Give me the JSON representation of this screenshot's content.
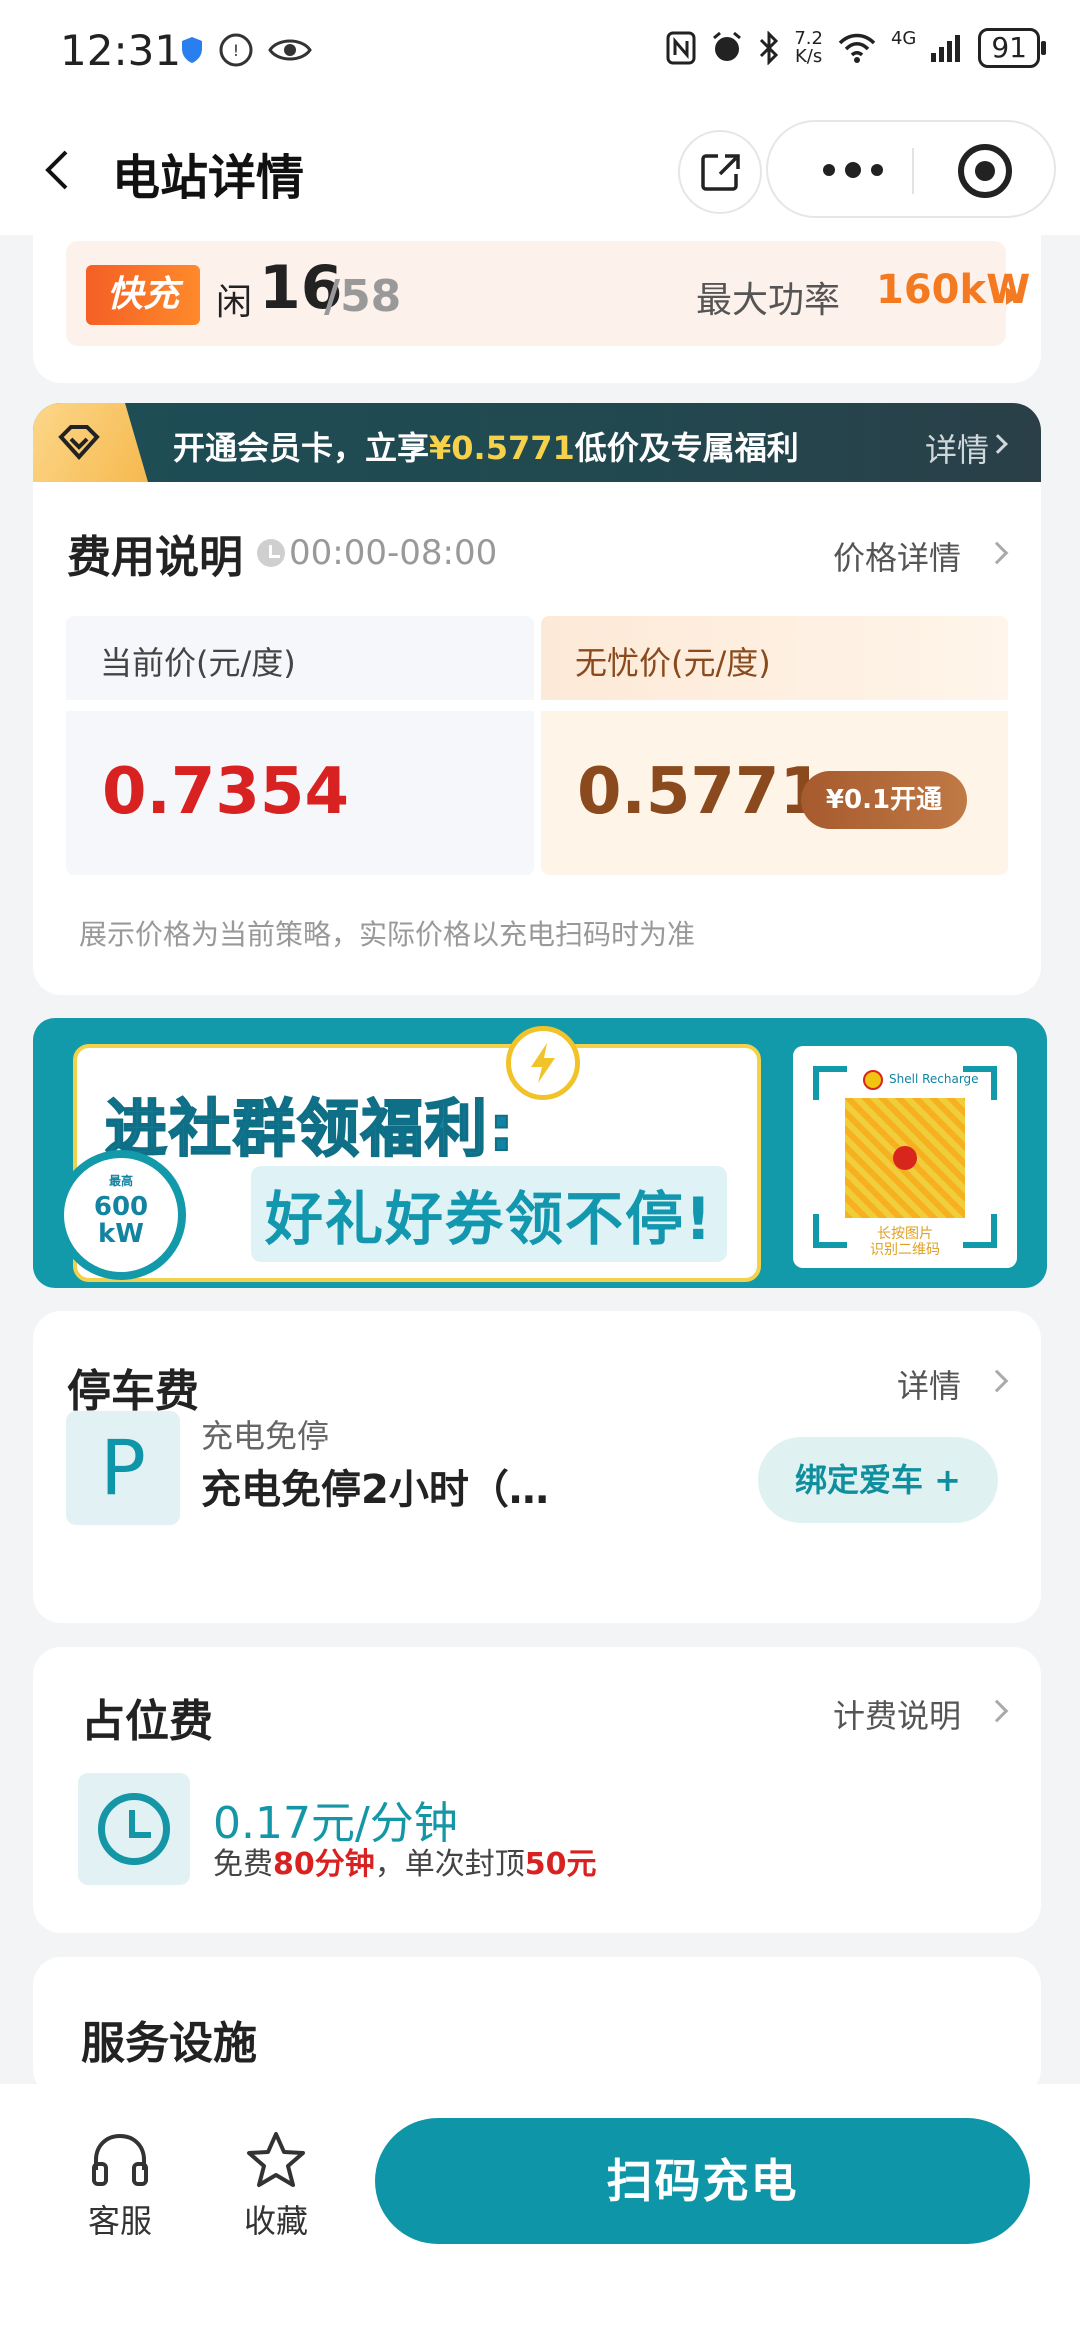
{
  "status_bar": {
    "time": "12:31",
    "net_speed_value": "7.2",
    "net_speed_unit": "K/s",
    "network_type": "4G",
    "battery": "91"
  },
  "nav": {
    "title": "电站详情"
  },
  "fast_charge": {
    "badge": "快充",
    "idle_label": "闲",
    "idle_count": "16",
    "total": "/58",
    "max_power_label": "最大功率",
    "max_power_value": "160kW"
  },
  "member_banner": {
    "text_prefix": "开通会员卡，立享",
    "highlight": "¥0.5771",
    "text_suffix": "低价及专属福利",
    "detail": "详情"
  },
  "fee": {
    "title": "费用说明",
    "time_range": "00:00-08:00",
    "price_detail_link": "价格详情",
    "current_label": "当前价(元/度)",
    "current_value": "0.7354",
    "vip_label": "无忧价(元/度)",
    "vip_value": "0.5771",
    "vip_button": "¥0.1开通",
    "note": "展示价格为当前策略，实际价格以充电扫码时为准"
  },
  "community_banner": {
    "title_line1": "进社群领福利:",
    "title_line2": "好礼好券领不停!",
    "badge_top": "最高",
    "badge_value": "600",
    "badge_unit": "kW",
    "qr_caption_line1": "长按图片",
    "qr_caption_line2": "识别二维码",
    "qr_brand": "Shell Recharge"
  },
  "parking": {
    "title": "停车费",
    "detail_link": "详情",
    "icon_letter": "P",
    "subtitle": "充电免停",
    "main_text": "充电免停2小时（…",
    "bind_button": "绑定爱车 +"
  },
  "occupancy": {
    "title": "占位费",
    "detail_link": "计费说明",
    "price": "0.17元/分钟",
    "note_prefix": "免费",
    "free_minutes": "80分钟",
    "note_mid": "，单次封顶",
    "cap": "50元"
  },
  "services": {
    "title": "服务设施"
  },
  "bottom_bar": {
    "service_label": "客服",
    "favorite_label": "收藏",
    "scan_button": "扫码充电"
  },
  "colors": {
    "brand_teal": "#0f95a8",
    "price_red": "#d82221",
    "vip_brown": "#8a4a1d",
    "fast_orange": "#f47a22"
  }
}
